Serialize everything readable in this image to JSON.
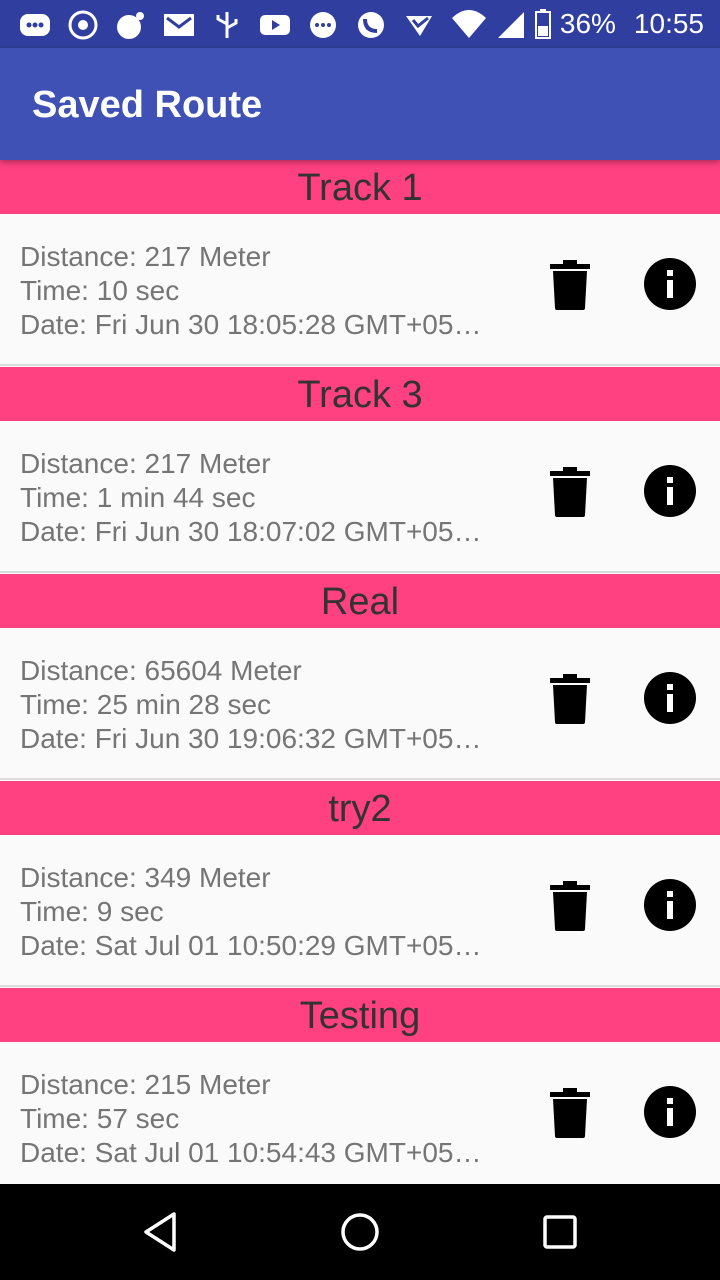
{
  "status_bar": {
    "battery_percent": "36%",
    "time": "10:55",
    "notification_icons": [
      "messages-icon",
      "whatsapp-icon",
      "app-icon",
      "gmail-icon",
      "usb-icon",
      "youtube-icon",
      "chat-icon",
      "phone-icon",
      "app-check-icon"
    ]
  },
  "app_bar": {
    "title": "Saved Route"
  },
  "tracks": [
    {
      "name": "Track 1",
      "distance": "Distance: 217 Meter",
      "time": "Time: 10 sec",
      "date": "Date: Fri Jun 30 18:05:28 GMT+05…"
    },
    {
      "name": "Track 3",
      "distance": "Distance: 217 Meter",
      "time": "Time: 1 min 44 sec",
      "date": "Date: Fri Jun 30 18:07:02 GMT+05…"
    },
    {
      "name": "Real",
      "distance": "Distance: 65604 Meter",
      "time": "Time: 25 min 28 sec",
      "date": "Date: Fri Jun 30 19:06:32 GMT+05…"
    },
    {
      "name": "try2",
      "distance": "Distance: 349 Meter",
      "time": "Time: 9 sec",
      "date": "Date: Sat Jul 01 10:50:29 GMT+05…"
    },
    {
      "name": "Testing",
      "distance": "Distance: 215 Meter",
      "time": "Time: 57 sec",
      "date": "Date: Sat Jul 01 10:54:43 GMT+05…"
    }
  ],
  "colors": {
    "primary": "#3F51B5",
    "primary_dark": "#303F9F",
    "accent": "#FF4081"
  }
}
